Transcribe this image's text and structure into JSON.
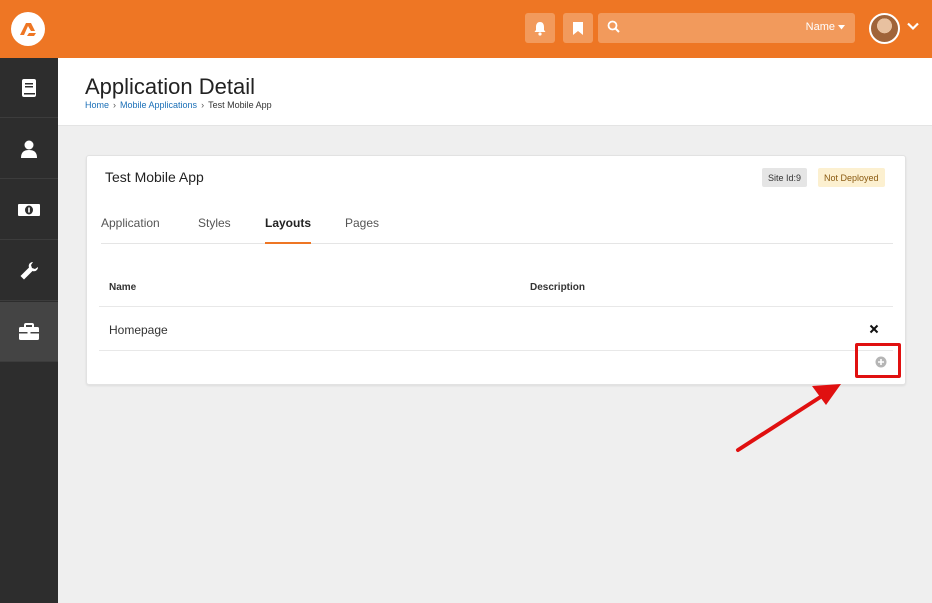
{
  "header": {
    "search_placeholder": "",
    "search_scope": "Name"
  },
  "sidebar": {
    "items": [
      {
        "icon": "book-icon"
      },
      {
        "icon": "person-icon"
      },
      {
        "icon": "money-icon"
      },
      {
        "icon": "wrench-icon"
      },
      {
        "icon": "briefcase-icon",
        "active": true
      }
    ]
  },
  "page": {
    "title": "Application Detail",
    "breadcrumb": [
      "Home",
      "Mobile Applications",
      "Test Mobile App"
    ]
  },
  "panel": {
    "title": "Test Mobile App",
    "site_id_badge": "Site Id:9",
    "deploy_badge": "Not Deployed",
    "tabs": [
      "Application",
      "Styles",
      "Layouts",
      "Pages"
    ],
    "active_tab": "Layouts",
    "table": {
      "columns": [
        "Name",
        "Description"
      ],
      "rows": [
        {
          "name": "Homepage",
          "description": ""
        }
      ]
    }
  },
  "colors": {
    "brand": "#ee7624",
    "sidebar": "#2d2d2d",
    "link": "#1a6fb7",
    "annotation": "#e01010"
  }
}
